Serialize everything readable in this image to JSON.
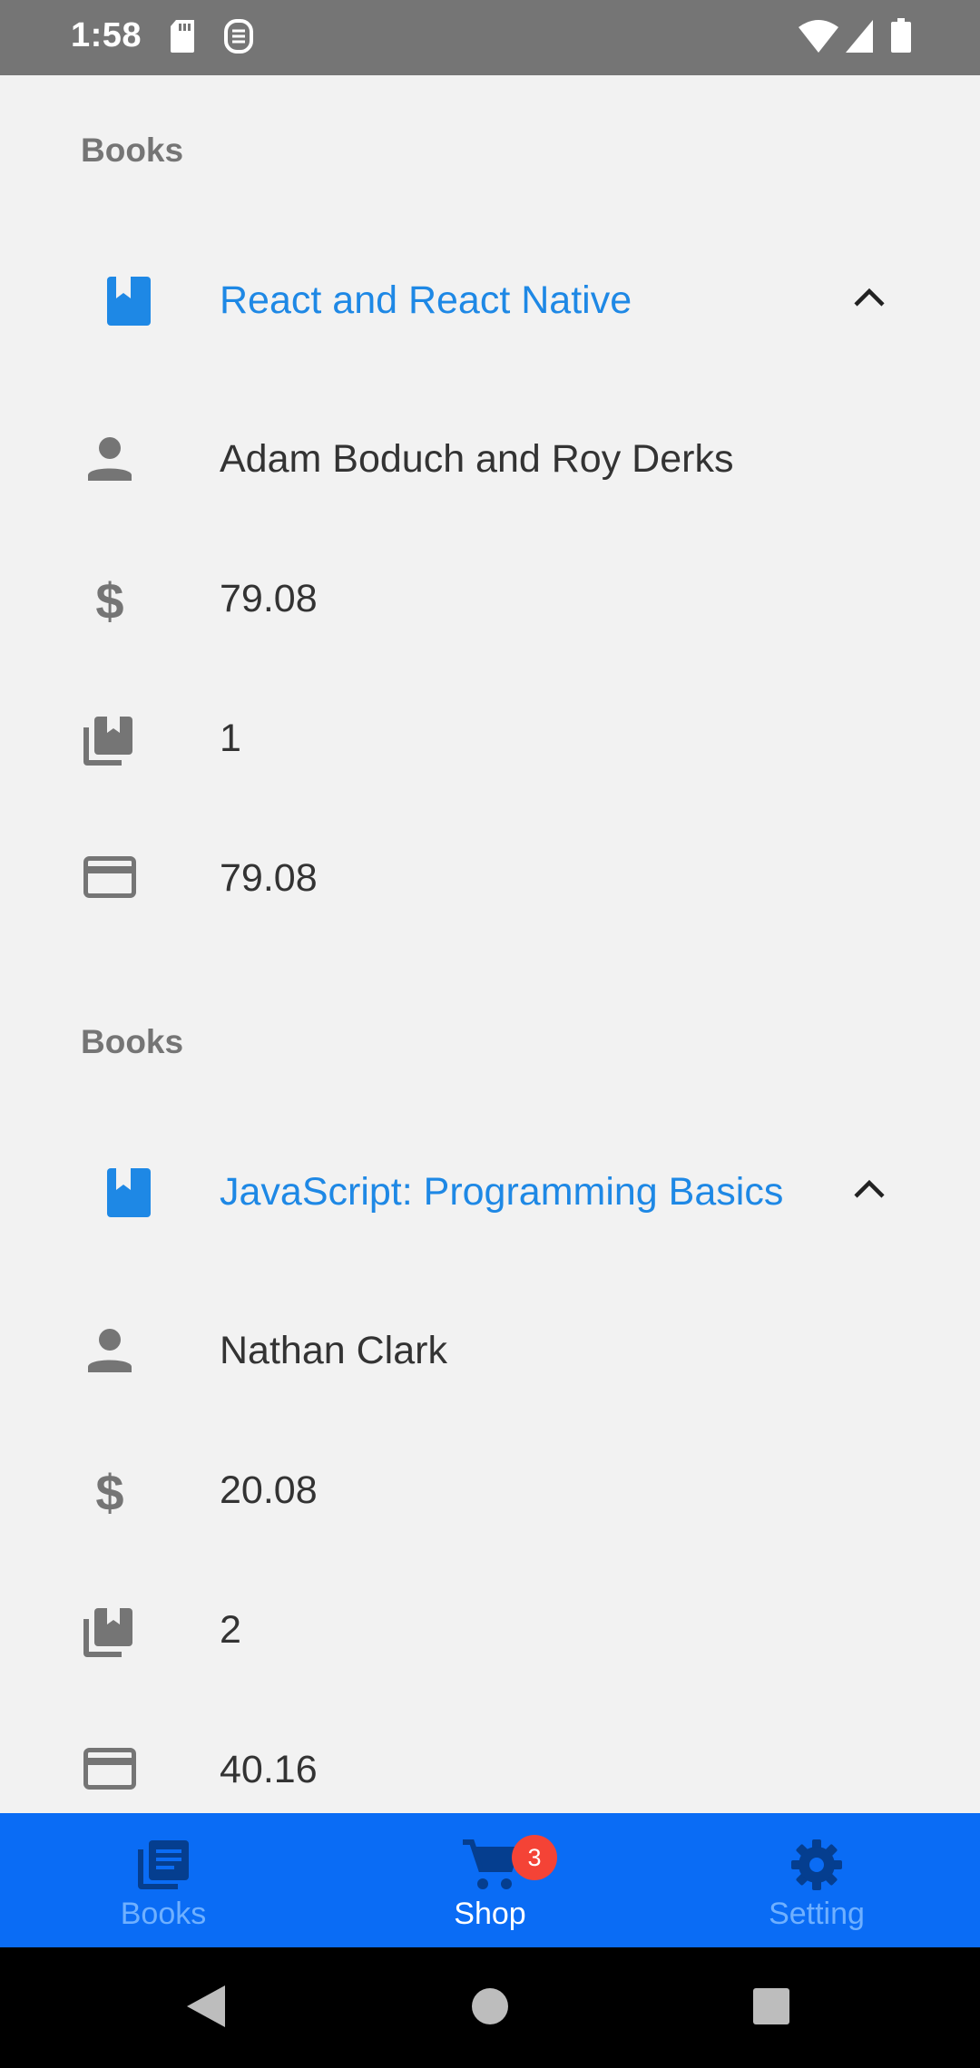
{
  "status_bar": {
    "time": "1:58",
    "icons": [
      "sd-card-icon",
      "accessibility-icon",
      "wifi-icon",
      "signal-icon",
      "battery-icon"
    ]
  },
  "books": [
    {
      "section_label": "Books",
      "title": "React and React Native",
      "author": "Adam Boduch and Roy Derks",
      "price": "79.08",
      "quantity": "1",
      "total": "79.08"
    },
    {
      "section_label": "Books",
      "title": "JavaScript: Programming Basics",
      "author": "Nathan Clark",
      "price": "20.08",
      "quantity": "2",
      "total": "40.16"
    }
  ],
  "bottom_nav": {
    "items": [
      {
        "label": "Books",
        "icon": "library-books-icon",
        "active": false
      },
      {
        "label": "Shop",
        "icon": "cart-icon",
        "active": true,
        "badge": "3"
      },
      {
        "label": "Setting",
        "icon": "gear-icon",
        "active": false
      }
    ]
  },
  "colors": {
    "accent": "#1e88e5",
    "nav_background": "#0a6cf5",
    "badge": "#f44336",
    "status_bar": "#757575",
    "background": "#f2f2f2"
  }
}
